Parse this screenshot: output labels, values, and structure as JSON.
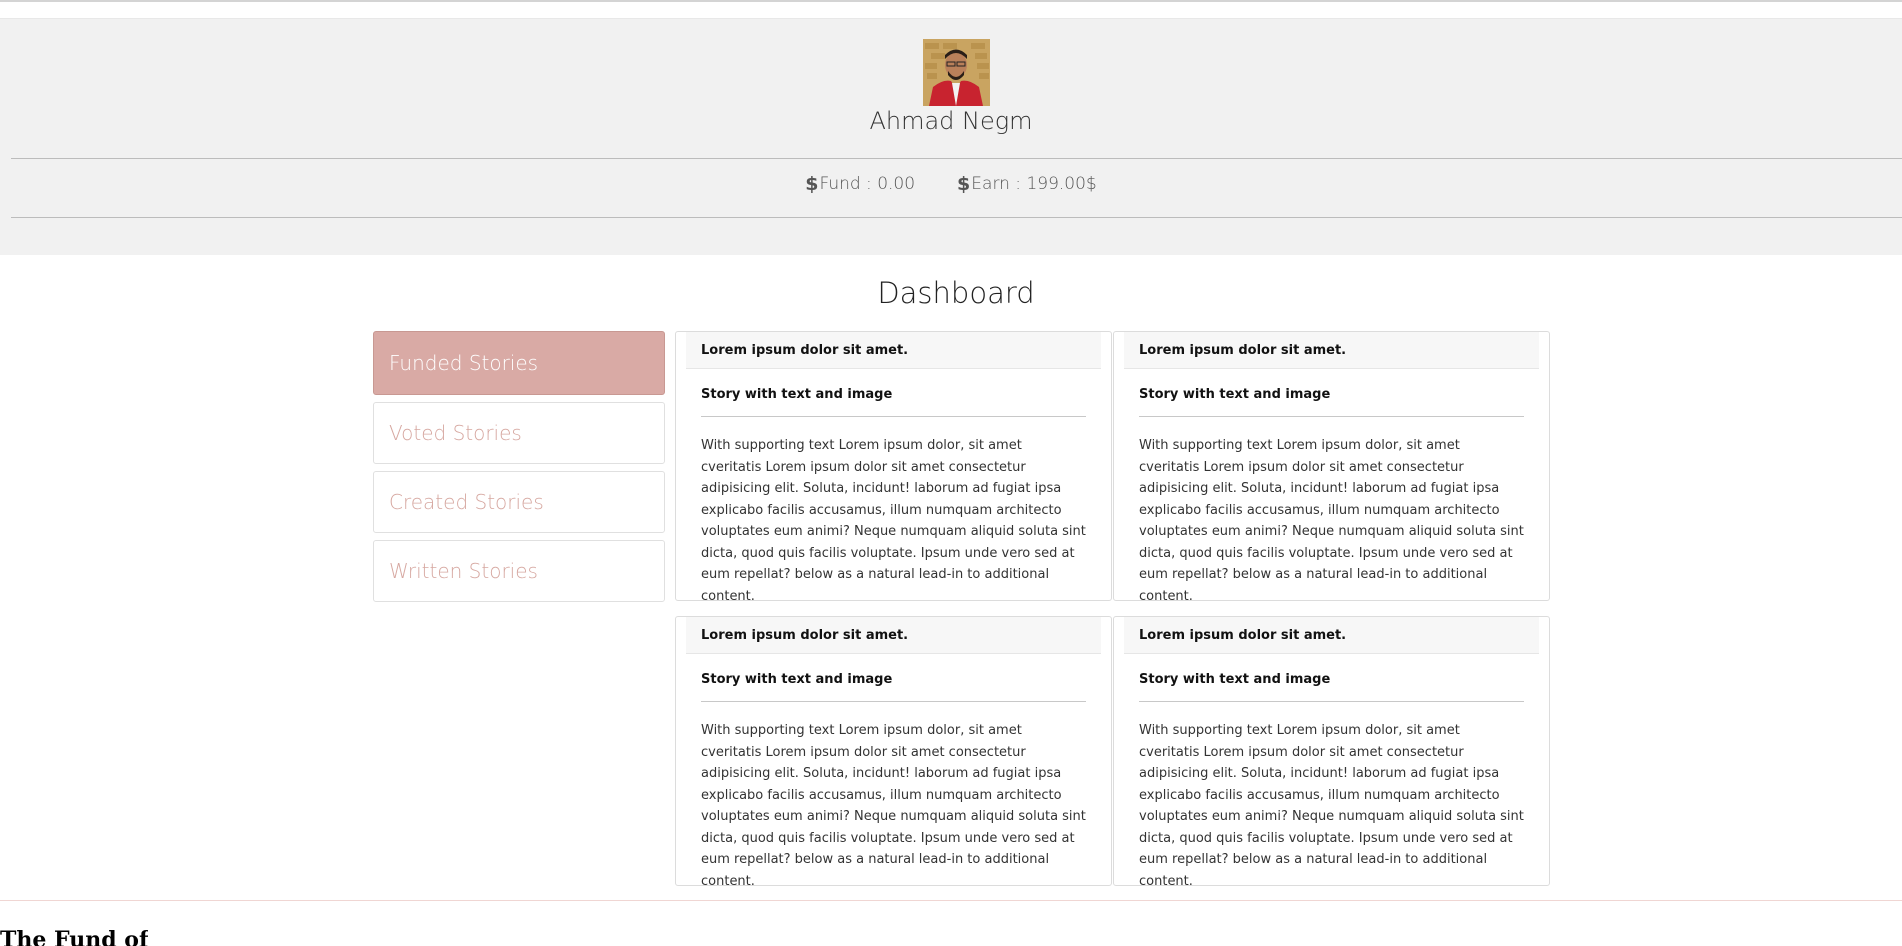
{
  "profile": {
    "name": "Ahmad Negm",
    "fund_label": "Fund : 0.00",
    "earn_label": "Earn : 199.00$",
    "stat_icon": "$"
  },
  "dashboard": {
    "title": "Dashboard"
  },
  "sidebar": {
    "items": [
      {
        "label": "Funded Stories",
        "active": true
      },
      {
        "label": "Voted Stories",
        "active": false
      },
      {
        "label": "Created Stories",
        "active": false
      },
      {
        "label": "Written Stories",
        "active": false
      }
    ]
  },
  "cards": [
    {
      "header": "Lorem ipsum dolor sit amet.",
      "title": "Story with text and image",
      "text": "With supporting text Lorem ipsum dolor, sit amet cveritatis Lorem ipsum dolor sit amet consectetur adipisicing elit. Soluta, incidunt! laborum ad fugiat ipsa explicabo facilis accusamus, illum numquam architecto voluptates eum animi? Neque numquam aliquid soluta sint dicta, quod quis facilis voluptate. Ipsum unde vero sed at eum repellat? below as a natural lead-in to additional content."
    },
    {
      "header": "Lorem ipsum dolor sit amet.",
      "title": "Story with text and image",
      "text": "With supporting text Lorem ipsum dolor, sit amet cveritatis Lorem ipsum dolor sit amet consectetur adipisicing elit. Soluta, incidunt! laborum ad fugiat ipsa explicabo facilis accusamus, illum numquam architecto voluptates eum animi? Neque numquam aliquid soluta sint dicta, quod quis facilis voluptate. Ipsum unde vero sed at eum repellat? below as a natural lead-in to additional content."
    },
    {
      "header": "Lorem ipsum dolor sit amet.",
      "title": "Story with text and image",
      "text": "With supporting text Lorem ipsum dolor, sit amet cveritatis Lorem ipsum dolor sit amet consectetur adipisicing elit. Soluta, incidunt! laborum ad fugiat ipsa explicabo facilis accusamus, illum numquam architecto voluptates eum animi? Neque numquam aliquid soluta sint dicta, quod quis facilis voluptate. Ipsum unde vero sed at eum repellat? below as a natural lead-in to additional content."
    },
    {
      "header": "Lorem ipsum dolor sit amet.",
      "title": "Story with text and image",
      "text": "With supporting text Lorem ipsum dolor, sit amet cveritatis Lorem ipsum dolor sit amet consectetur adipisicing elit. Soluta, incidunt! laborum ad fugiat ipsa explicabo facilis accusamus, illum numquam architecto voluptates eum animi? Neque numquam aliquid soluta sint dicta, quod quis facilis voluptate. Ipsum unde vero sed at eum repellat? below as a natural lead-in to additional content."
    }
  ],
  "footer": {
    "brand": "The Fund of"
  },
  "colors": {
    "accent": "#d9aaa5",
    "accent_text": "#d6a7a0",
    "profile_bg": "#f1f1f1"
  }
}
